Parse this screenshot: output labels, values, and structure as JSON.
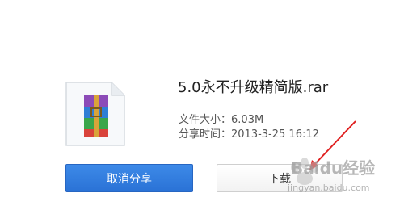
{
  "file": {
    "icon": "winrar-archive-icon",
    "name": "5.0永不升级精简版.rar",
    "size_label": "文件大小：",
    "size_value": "6.03M",
    "time_label": "分享时间：",
    "time_value": "2013-3-25 16:12"
  },
  "actions": {
    "cancel_share_label": "取消分享",
    "download_label": "下载"
  },
  "watermark": {
    "text": "Baidu经验",
    "url": "jingyan.baidu.com"
  },
  "colors": {
    "primary_button": "#2a72d6",
    "annotation_arrow": "#e02020"
  }
}
